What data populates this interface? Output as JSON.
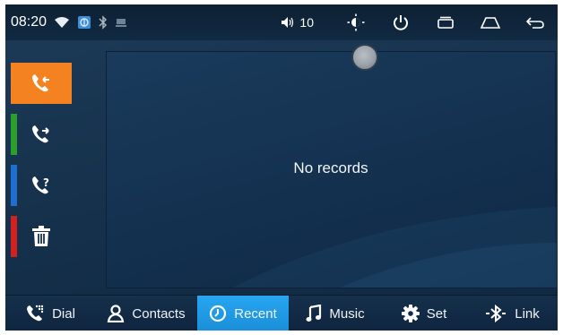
{
  "statusbar": {
    "time": "08:20",
    "icons": [
      "wifi-icon",
      "sim-icon",
      "bluetooth-icon",
      "usb-icon"
    ],
    "volume_level": "10",
    "buttons": [
      "brightness-icon",
      "power-icon",
      "recent-apps-icon",
      "home-icon",
      "back-icon"
    ]
  },
  "sidenav": {
    "items": [
      {
        "name": "incoming-calls",
        "icon": "call-incoming-icon",
        "accent": "#f58220",
        "active": true
      },
      {
        "name": "outgoing-calls",
        "icon": "call-outgoing-icon",
        "accent": "#2aa02a",
        "active": false
      },
      {
        "name": "missed-calls",
        "icon": "call-missed-icon",
        "accent": "#1f6fd1",
        "active": false
      },
      {
        "name": "delete",
        "icon": "trash-icon",
        "accent": "#d32020",
        "active": false
      }
    ]
  },
  "panel": {
    "message": "No records"
  },
  "tabs": [
    {
      "label": "Dial",
      "icon": "dialpad-phone-icon",
      "active": false
    },
    {
      "label": "Contacts",
      "icon": "person-icon",
      "active": false
    },
    {
      "label": "Recent",
      "icon": "clock-icon",
      "active": true
    },
    {
      "label": "Music",
      "icon": "music-note-icon",
      "active": false
    },
    {
      "label": "Set",
      "icon": "gear-icon",
      "active": false
    },
    {
      "label": "Link",
      "icon": "bluetooth-link-icon",
      "active": false
    }
  ],
  "colors": {
    "active_side": "#f58220",
    "active_tab": "#1f9be3",
    "background": "#16324d"
  }
}
